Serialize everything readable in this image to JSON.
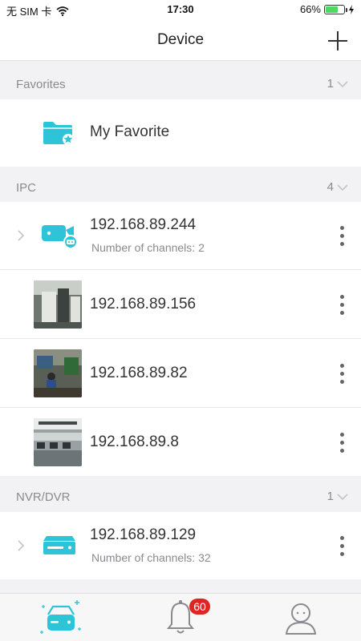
{
  "status_bar": {
    "carrier": "无 SIM 卡",
    "time": "17:30",
    "battery": "66%",
    "battery_level": 0.66
  },
  "header": {
    "title": "Device"
  },
  "sections": [
    {
      "label": "Favorites",
      "count": "1"
    },
    {
      "label": "IPC",
      "count": "4"
    },
    {
      "label": "NVR/DVR",
      "count": "1"
    }
  ],
  "favorites": {
    "label": "My Favorite"
  },
  "ipc": [
    {
      "name": "192.168.89.244",
      "sub": "Number of channels: 2"
    },
    {
      "name": "192.168.89.156"
    },
    {
      "name": "192.168.89.82"
    },
    {
      "name": "192.168.89.8"
    }
  ],
  "nvr": [
    {
      "name": "192.168.89.129",
      "sub": "Number of channels: 32"
    }
  ],
  "tabs": {
    "alerts_badge": "60"
  },
  "colors": {
    "accent": "#2ec4d8",
    "badge": "#e02424"
  },
  "icons": [
    "wifi-icon",
    "add-icon",
    "chevron-down-icon",
    "folder-star-icon",
    "chevron-right-icon",
    "camera-icon",
    "more-vertical-icon",
    "nvr-icon",
    "device-tab-icon",
    "bell-icon",
    "user-icon"
  ]
}
